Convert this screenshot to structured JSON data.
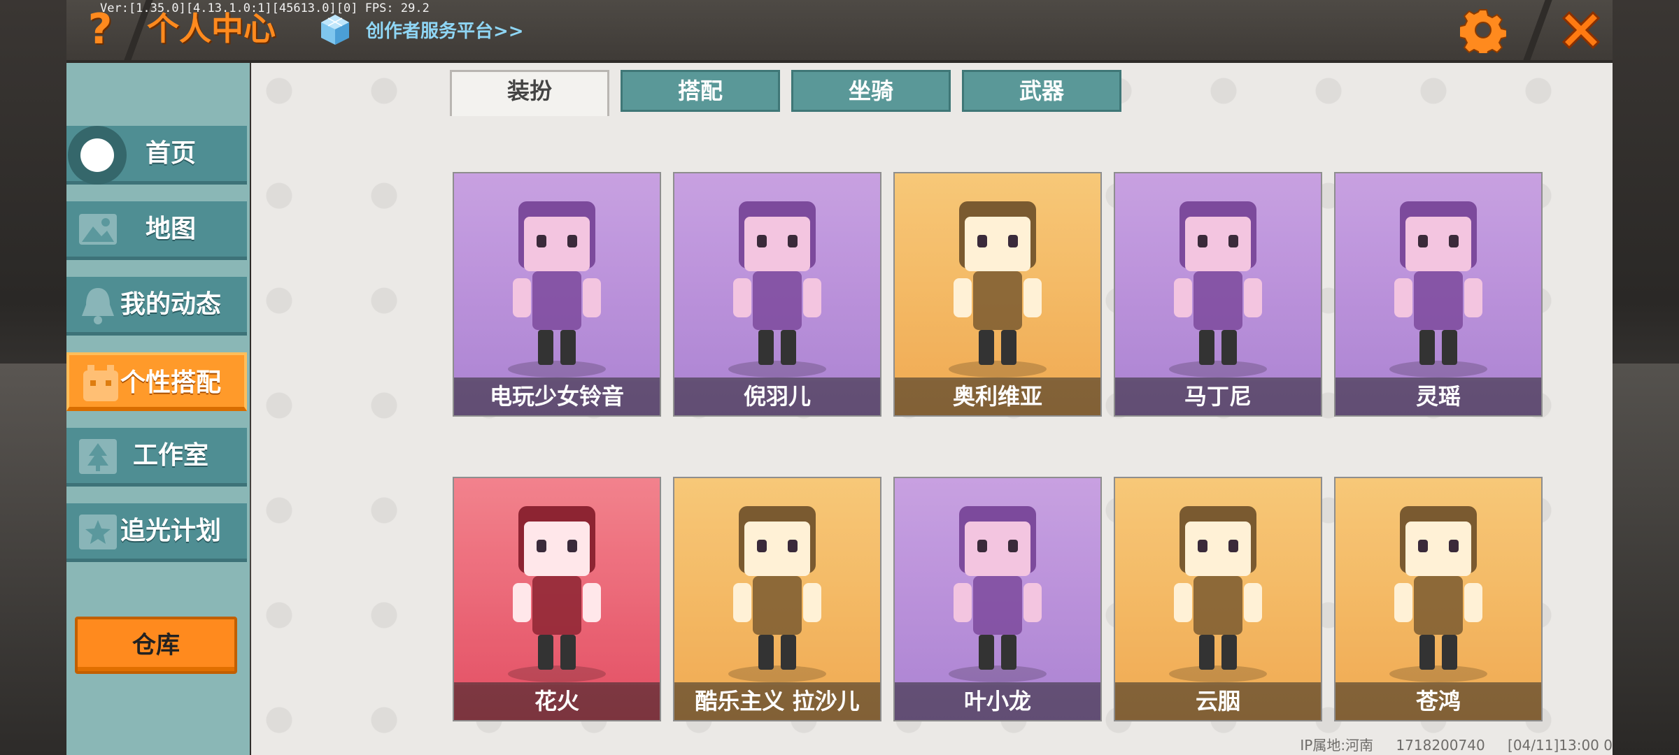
{
  "debug_text": "Ver:[1.35.0][4.13.1.0:1][45613.0][0] FPS: 29.2",
  "header": {
    "help_icon": "question-mark-icon",
    "title": "个人中心",
    "creator_link": "创作者服务平台>>",
    "settings_icon": "gear-icon",
    "close_icon": "close-icon",
    "accent_color": "#ff8a1e"
  },
  "sidebar": {
    "items": [
      {
        "label": "首页",
        "icon": "home-icon"
      },
      {
        "label": "地图",
        "icon": "map-icon"
      },
      {
        "label": "我的动态",
        "icon": "bell-icon"
      },
      {
        "label": "个性搭配",
        "icon": "avatar-icon",
        "active": true
      },
      {
        "label": "工作室",
        "icon": "tree-icon"
      },
      {
        "label": "追光计划",
        "icon": "star-icon"
      }
    ],
    "warehouse_label": "仓库"
  },
  "tabs": [
    {
      "label": "装扮",
      "active": true
    },
    {
      "label": "搭配"
    },
    {
      "label": "坐骑"
    },
    {
      "label": "武器"
    }
  ],
  "characters": [
    {
      "name": "电玩少女铃音",
      "bg": "purple"
    },
    {
      "name": "倪羽儿",
      "bg": "purple"
    },
    {
      "name": "奥利维亚",
      "bg": "orange"
    },
    {
      "name": "马丁尼",
      "bg": "purple"
    },
    {
      "name": "灵瑶",
      "bg": "purple"
    },
    {
      "name": "花火",
      "bg": "red"
    },
    {
      "name": "酷乐主义 拉沙儿",
      "bg": "orange"
    },
    {
      "name": "叶小龙",
      "bg": "purple"
    },
    {
      "name": "云胭",
      "bg": "orange"
    },
    {
      "name": "苍鸿",
      "bg": "orange"
    }
  ],
  "footer": {
    "ip_location": "IP属地:河南",
    "user_id": "1718200740",
    "date": "[04/11]13:00 0"
  }
}
